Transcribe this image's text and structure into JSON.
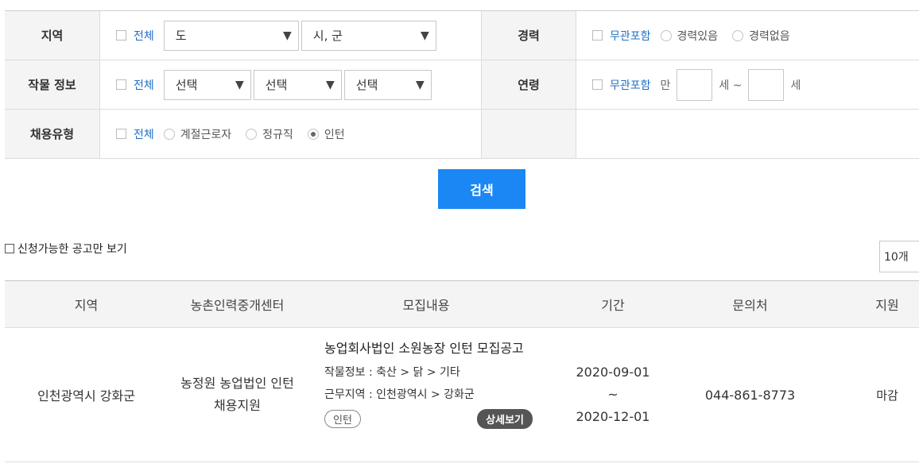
{
  "filters": {
    "region": {
      "label": "지역",
      "all_label": "전체",
      "province_select": "도",
      "city_select": "시, 군"
    },
    "crop": {
      "label": "작물 정보",
      "all_label": "전체",
      "selects": [
        "선택",
        "선택",
        "선택"
      ]
    },
    "employment": {
      "label": "채용유형",
      "all_label": "전체",
      "options": [
        {
          "label": "계절근로자",
          "selected": false
        },
        {
          "label": "정규직",
          "selected": false
        },
        {
          "label": "인턴",
          "selected": true
        }
      ]
    },
    "career": {
      "label": "경력",
      "any_label": "무관포함",
      "options": [
        {
          "label": "경력있음",
          "selected": false
        },
        {
          "label": "경력없음",
          "selected": false
        }
      ]
    },
    "age": {
      "label": "연령",
      "any_label": "무관포함",
      "prefix": "만",
      "from_unit": "세 ~",
      "to_unit": "세"
    }
  },
  "search_label": "검색",
  "available_only_label": "신청가능한 공고만 보기",
  "per_page": "10개",
  "table": {
    "headers": [
      "지역",
      "농촌인력중개센터",
      "모집내용",
      "기간",
      "문의처",
      "지원"
    ],
    "rows": [
      {
        "region": "인천광역시  강화군",
        "center": "농정원 농업법인 인턴 채용지원",
        "title": "농업회사법인 소원농장 인턴 모집공고",
        "crop_info": "작물정보 : 축산 > 닭 > 기타",
        "work_area": "근무지역 : 인천광역시 > 강화군",
        "type_badge": "인턴",
        "detail_button": "상세보기",
        "period_start": "2020-09-01",
        "period_sep": "~",
        "period_end": "2020-12-01",
        "contact": "044-861-8773",
        "status": "마감"
      }
    ]
  },
  "colors": {
    "accent": "#1a87f5",
    "link_blue": "#1f6fc6",
    "header_bg": "#f4f4f4"
  }
}
